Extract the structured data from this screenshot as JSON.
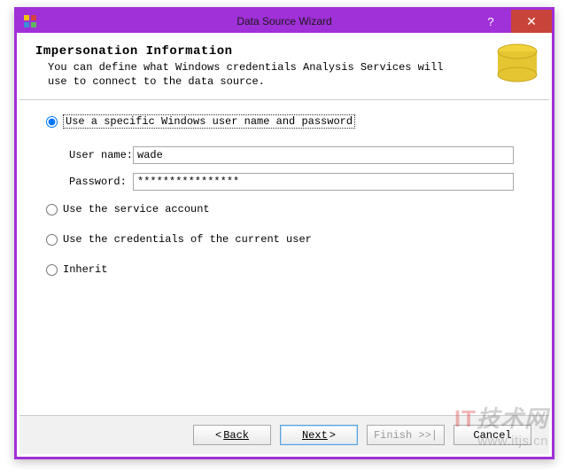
{
  "window": {
    "title": "Data Source Wizard"
  },
  "header": {
    "title": "Impersonation Information",
    "description": "You can define what Windows credentials Analysis Services will use to connect to the data source."
  },
  "options": {
    "specific": "Use a specific Windows user name and password",
    "service": "Use the service account",
    "current": "Use the credentials of the current user",
    "inherit": "Inherit"
  },
  "form": {
    "username_label": "User name:",
    "username_value": "wade",
    "password_label": "Password:",
    "password_value": "****************"
  },
  "buttons": {
    "back": "Back",
    "next": "Next",
    "finish": "Finish >>|",
    "cancel": "Cancel"
  },
  "watermark": {
    "badge_prefix": "IT",
    "badge_suffix": "技术网",
    "url": "www.itjs.cn"
  }
}
